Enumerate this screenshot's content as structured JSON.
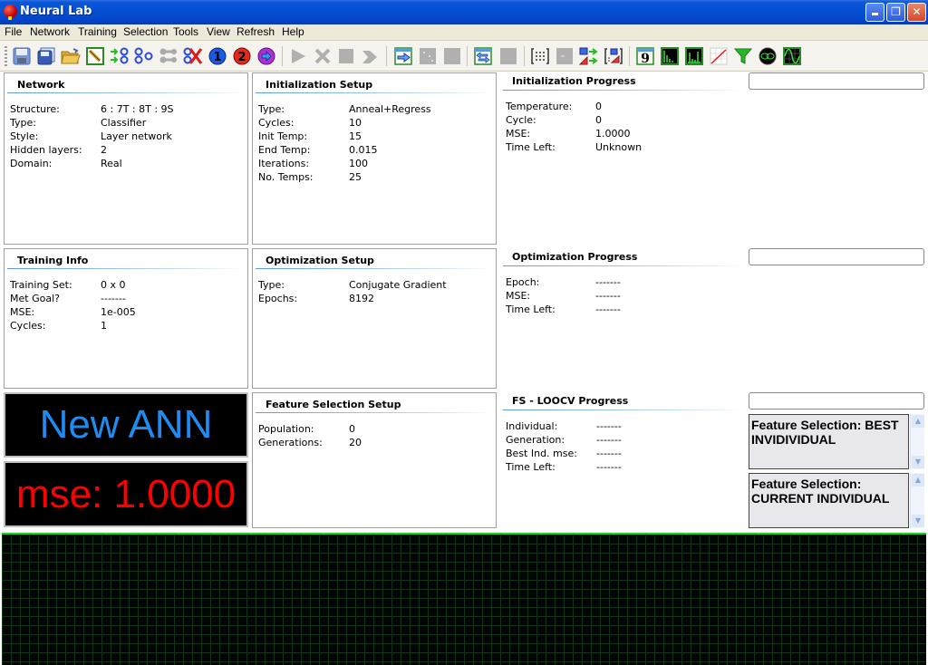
{
  "window": {
    "title": "Neural Lab",
    "controls": [
      "minimize",
      "restore",
      "close"
    ]
  },
  "menu": [
    "File",
    "Network",
    "Training",
    "Selection",
    "Tools",
    "View",
    "Refresh",
    "Help"
  ],
  "toolbar": {
    "icons": [
      "save-icon",
      "save-as-icon",
      "open-folder-icon",
      "edit-pencil-icon",
      "network-inputs-icon",
      "network-nodes-icon",
      "network-disabled-icon",
      "delete-network-icon",
      "step-one-icon",
      "step-two-icon",
      "next-arrow-icon",
      "play-icon",
      "stop-x-icon",
      "stop-square-icon",
      "skip-icon",
      "import-table-icon",
      "scatter-disabled-icon",
      "square-disabled-icon",
      "exchange-table-icon",
      "square-disabled-icon-2",
      "matrix-icon",
      "minus-box-icon",
      "transform-shapes-icon",
      "matrix-shapes-icon",
      "table-nine-icon",
      "histogram-icon",
      "histogram-peaks-icon",
      "line-chart-icon",
      "filter-icon",
      "orbit-icon",
      "sine-wave-icon"
    ]
  },
  "network": {
    "title": "Network",
    "rows": [
      {
        "k": "Structure:",
        "v": "6 : 7T : 8T : 9S"
      },
      {
        "k": "Type:",
        "v": "Classifier"
      },
      {
        "k": "Style:",
        "v": "Layer network"
      },
      {
        "k": "Hidden layers:",
        "v": "2"
      },
      {
        "k": "Domain:",
        "v": "Real"
      }
    ]
  },
  "init_setup": {
    "title": "Initialization Setup",
    "rows": [
      {
        "k": "Type:",
        "v": "Anneal+Regress"
      },
      {
        "k": "Cycles:",
        "v": "10"
      },
      {
        "k": "Init Temp:",
        "v": "15"
      },
      {
        "k": "End Temp:",
        "v": "0.015"
      },
      {
        "k": "Iterations:",
        "v": "100"
      },
      {
        "k": "No. Temps:",
        "v": "25"
      }
    ]
  },
  "init_progress": {
    "title": "Initialization Progress",
    "rows": [
      {
        "k": "Temperature:",
        "v": "0"
      },
      {
        "k": "Cycle:",
        "v": "0"
      },
      {
        "k": "MSE:",
        "v": "1.0000"
      },
      {
        "k": "Time Left:",
        "v": "Unknown"
      }
    ],
    "progress": 0
  },
  "training_info": {
    "title": "Training Info",
    "rows": [
      {
        "k": "Training Set:",
        "v": "0 x 0"
      },
      {
        "k": "Met Goal?",
        "v": "-------"
      },
      {
        "k": "MSE:",
        "v": "1e-005"
      },
      {
        "k": "Cycles:",
        "v": "1"
      }
    ]
  },
  "opt_setup": {
    "title": "Optimization Setup",
    "rows": [
      {
        "k": "Type:",
        "v": "Conjugate Gradient"
      },
      {
        "k": "Epochs:",
        "v": "8192"
      }
    ]
  },
  "opt_progress": {
    "title": "Optimization Progress",
    "rows": [
      {
        "k": "Epoch:",
        "v": "-------"
      },
      {
        "k": "MSE:",
        "v": "-------"
      },
      {
        "k": "Time Left:",
        "v": "-------"
      }
    ],
    "progress": 0
  },
  "status": {
    "name": "New ANN",
    "mse": "mse: 1.0000",
    "name_color": "#1e8cf0",
    "mse_color": "#ff0000"
  },
  "fs_setup": {
    "title": "Feature Selection Setup",
    "rows": [
      {
        "k": "Population:",
        "v": "0"
      },
      {
        "k": "Generations:",
        "v": "20"
      }
    ]
  },
  "fs_progress": {
    "title": "FS - LOOCV Progress",
    "rows": [
      {
        "k": "Individual:",
        "v": "-------"
      },
      {
        "k": "Generation:",
        "v": "-------"
      },
      {
        "k": "Best Ind. mse:",
        "v": "-------"
      },
      {
        "k": "Time Left:",
        "v": "-------"
      }
    ],
    "progress": 0,
    "best_box": "Feature Selection: BEST INVIDIVIDUAL",
    "current_box": "Feature Selection: CURRENT INDIVIDUAL"
  }
}
